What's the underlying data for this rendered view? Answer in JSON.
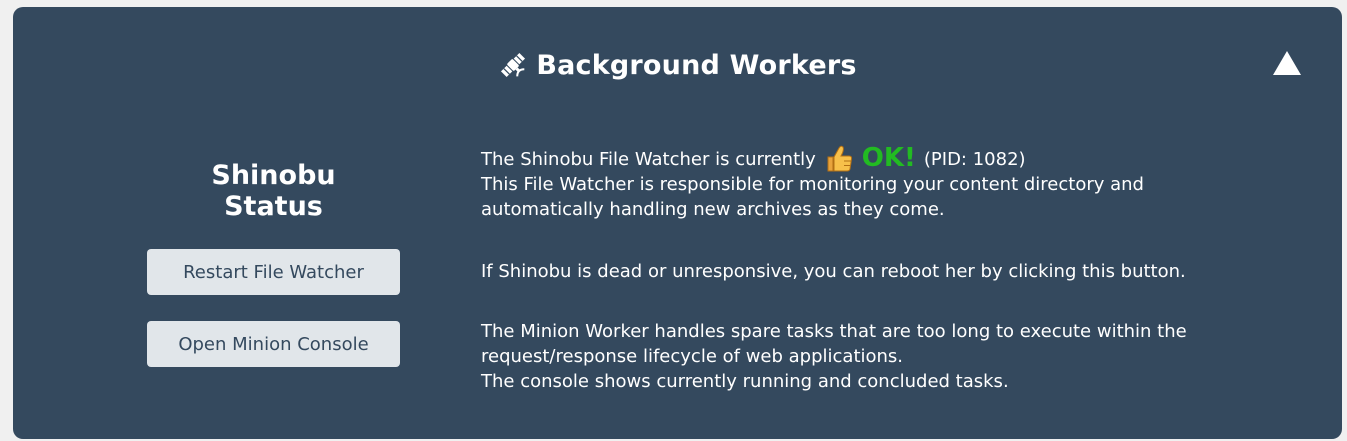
{
  "header": {
    "title": "Background Workers",
    "icon": "satellite-icon",
    "toggle_icon": "triangle-up-icon"
  },
  "status": {
    "title": "Shinobu Status",
    "watcher_prefix": "The Shinobu File Watcher is currently",
    "state_icon": "thumbs-up-icon",
    "state_text": "OK!",
    "pid_text": "(PID: 1082)",
    "description_lines": [
      "This File Watcher is responsible for monitoring your content directory and",
      "automatically handling new archives as they come."
    ]
  },
  "actions": {
    "restart_label": "Restart File Watcher",
    "restart_description": "If Shinobu is dead or unresponsive, you can reboot her by clicking this button.",
    "minion_label": "Open Minion Console",
    "minion_description_lines": [
      "The Minion Worker handles spare tasks that are too long to execute within the",
      "request/response lifecycle of web applications.",
      "The console shows currently running and concluded tasks."
    ]
  },
  "colors": {
    "panel_background": "#34495e",
    "button_background": "#e1e6ea",
    "ok_green": "#22bb22"
  }
}
